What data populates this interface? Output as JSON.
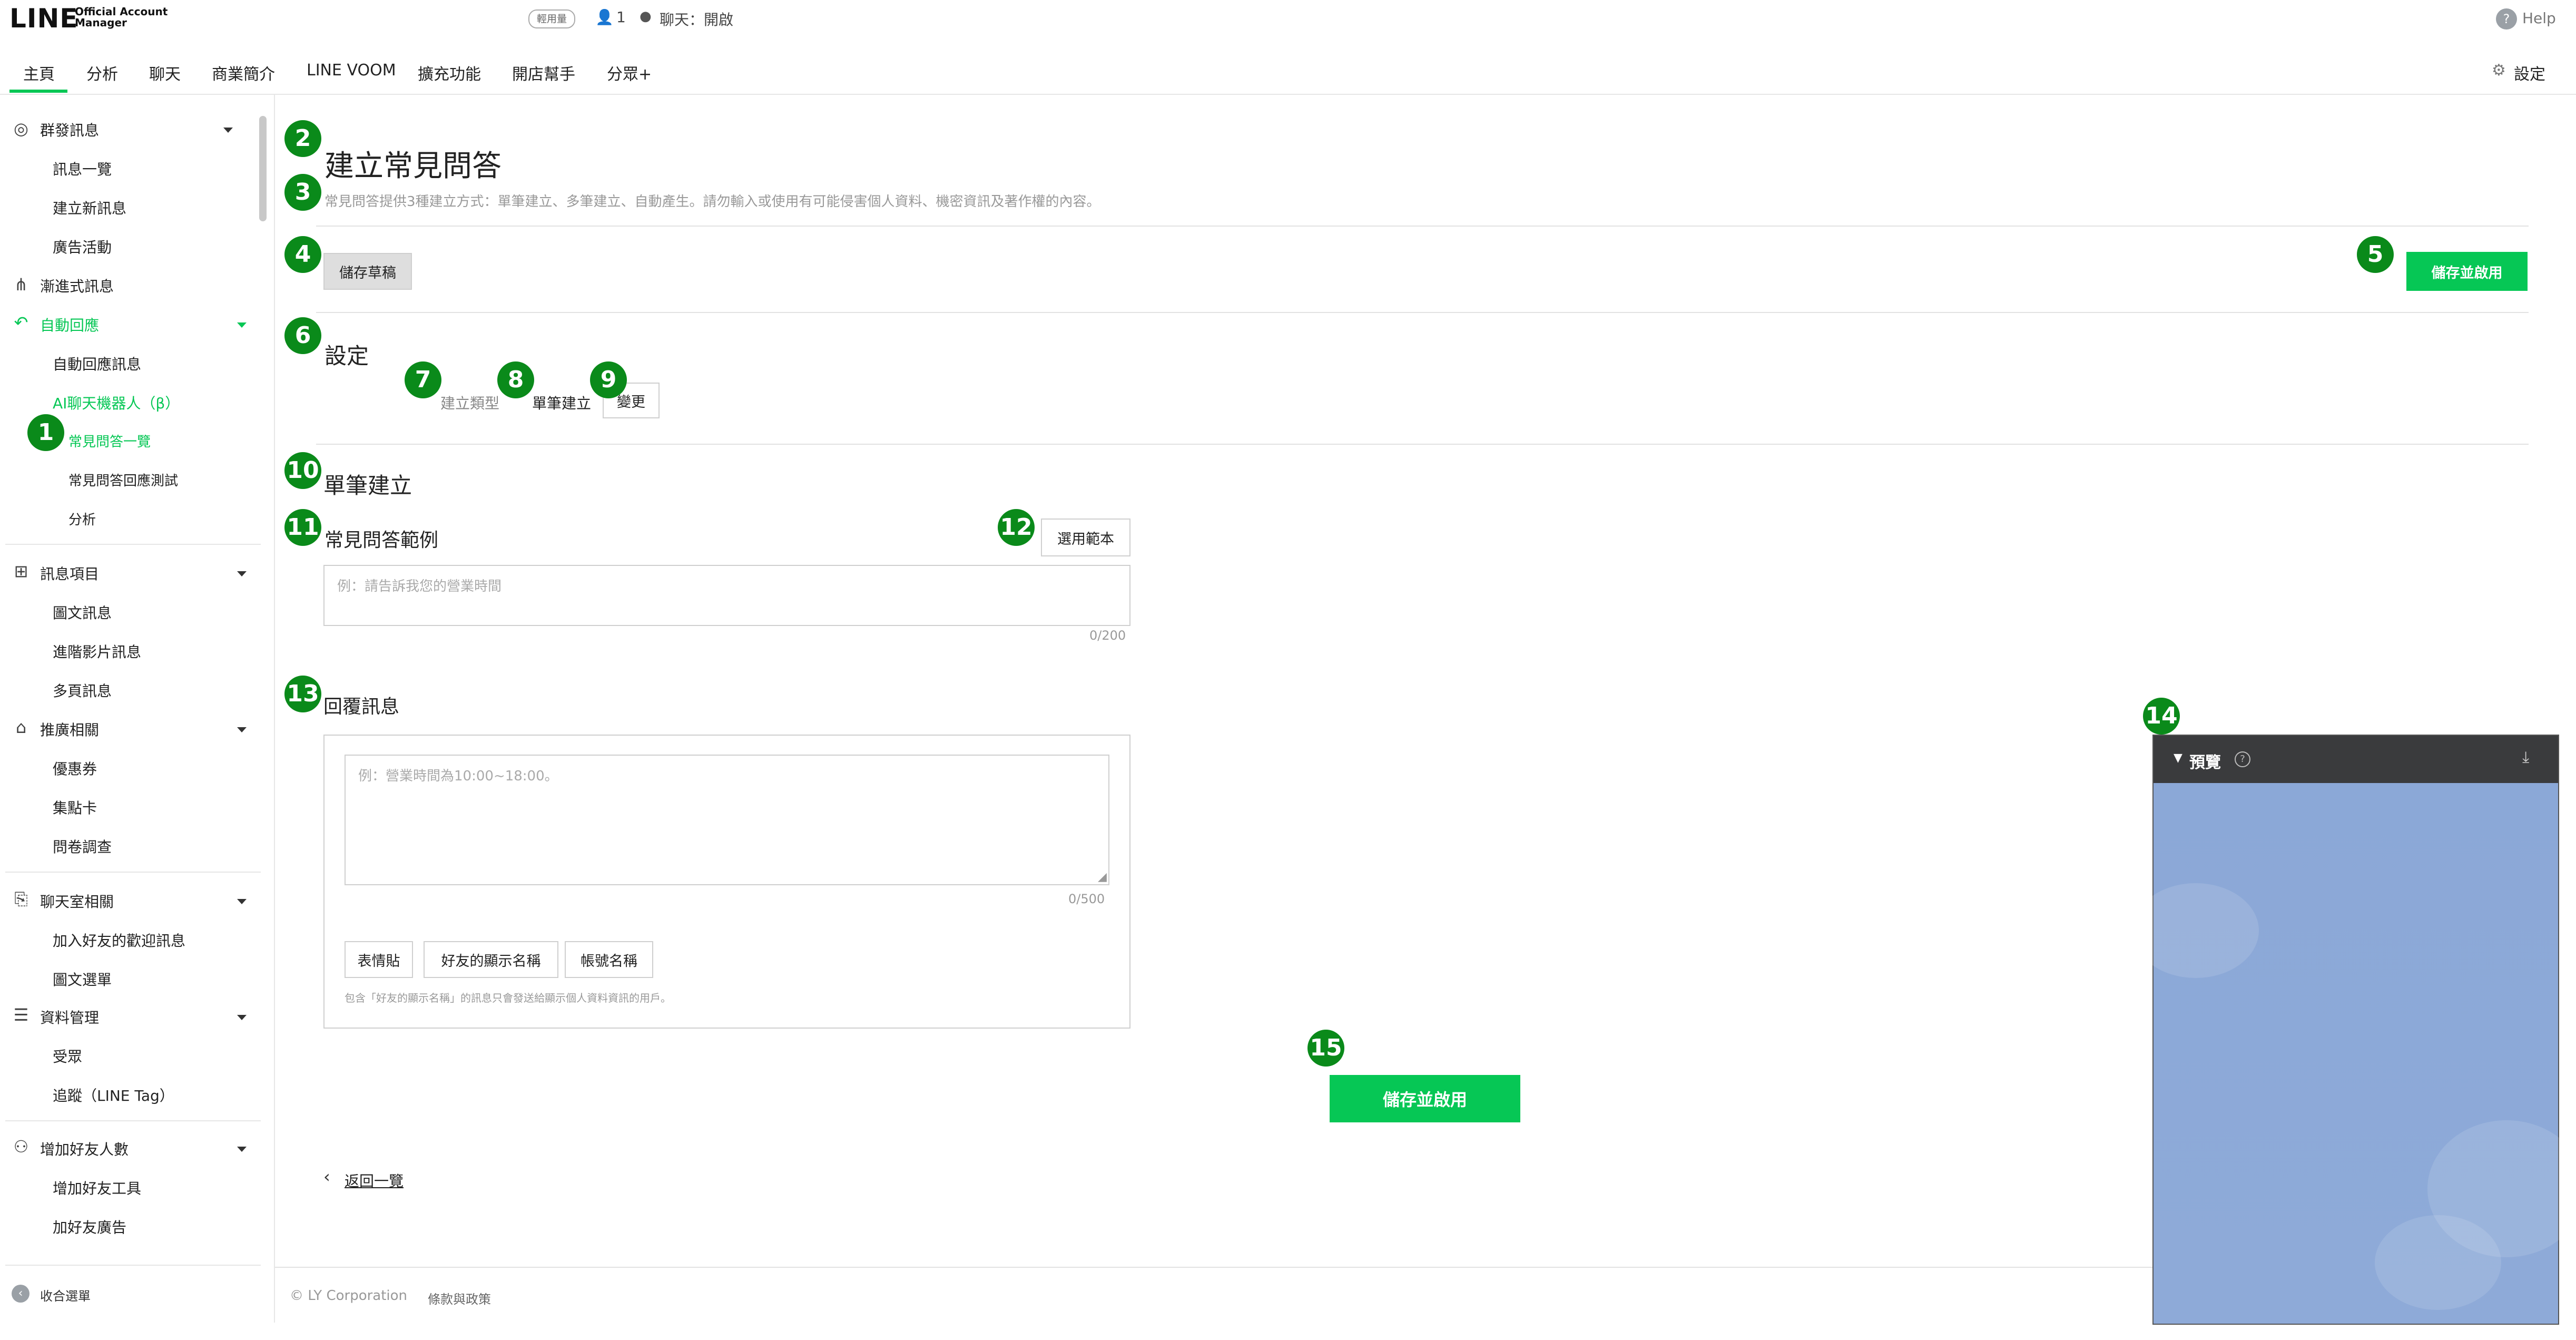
{
  "header": {
    "logo": "LINE",
    "logo_sub_1": "Official Account",
    "logo_sub_2": "Manager",
    "plan_badge": "輕用量",
    "friends_count": "1",
    "chat_status": "聊天：開啟",
    "help": "Help"
  },
  "nav": {
    "items": [
      "主頁",
      "分析",
      "聊天",
      "商業簡介",
      "LINE VOOM",
      "擴充功能",
      "開店幫手",
      "分眾+"
    ],
    "settings": "設定"
  },
  "sidebar": {
    "broadcast": "群發訊息",
    "message_list": "訊息一覽",
    "create_message": "建立新訊息",
    "ad_campaign": "廣告活動",
    "step_message": "漸進式訊息",
    "auto_reply": "自動回應",
    "auto_reply_message": "自動回應訊息",
    "ai_chatbot": "AI聊天機器人（β）",
    "faq_list": "常見問答一覽",
    "faq_test": "常見問答回應測試",
    "analysis": "分析",
    "message_items": "訊息項目",
    "rich_message": "圖文訊息",
    "rich_video": "進階影片訊息",
    "card_message": "多頁訊息",
    "promotion": "推廣相關",
    "coupon": "優惠券",
    "reward_card": "集點卡",
    "survey": "問卷調查",
    "chat_room": "聊天室相關",
    "greeting": "加入好友的歡迎訊息",
    "rich_menu": "圖文選單",
    "data_mgmt": "資料管理",
    "audience": "受眾",
    "tracking": "追蹤（LINE Tag）",
    "add_friends": "增加好友人數",
    "add_friend_tool": "增加好友工具",
    "friend_ads": "加好友廣告",
    "collapse": "收合選單"
  },
  "page": {
    "title": "建立常見問答",
    "description": "常見問答提供3種建立方式：單筆建立、多筆建立、自動產生。請勿輸入或使用有可能侵害個人資料、機密資訊及著作權的內容。",
    "save_draft": "儲存草稿",
    "save_enable": "儲存並啟用",
    "settings_heading": "設定",
    "creation_type_label": "建立類型",
    "creation_type_value": "單筆建立",
    "change_button": "變更",
    "single_heading": "單筆建立",
    "faq_example_label": "常見問答範例",
    "use_template": "選用範本",
    "faq_placeholder": "例：請告訴我您的營業時間",
    "faq_counter": "0/200",
    "reply_label": "回覆訊息",
    "reply_placeholder": "例：營業時間為10:00~18:00。",
    "reply_counter": "0/500",
    "emoji_btn": "表情貼",
    "friend_name_btn": "好友的顯示名稱",
    "account_name_btn": "帳號名稱",
    "note": "包含「好友的顯示名稱」的訊息只會發送給顯示個人資料資訊的用戶。",
    "back_link": "返回一覽",
    "save_enable_bottom": "儲存並啟用"
  },
  "preview": {
    "title": "預覽"
  },
  "footer": {
    "copyright": "© LY Corporation",
    "terms": "條款與政策"
  },
  "annotations": [
    "1",
    "2",
    "3",
    "4",
    "5",
    "6",
    "7",
    "8",
    "9",
    "10",
    "11",
    "12",
    "13",
    "14",
    "15"
  ],
  "colors": {
    "brand_green": "#06c755",
    "badge_green": "#0a8a1a",
    "preview_bg": "#8ba8d7"
  }
}
